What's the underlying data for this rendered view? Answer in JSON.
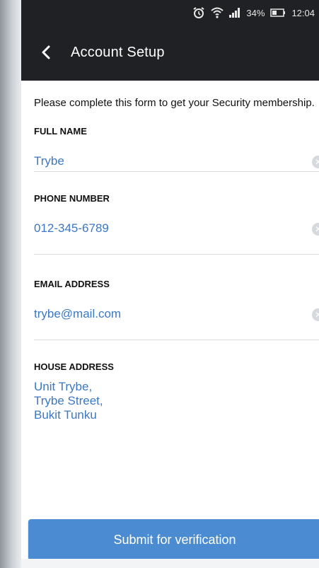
{
  "status_bar": {
    "battery": "34%",
    "time": "12:04",
    "icons": [
      "alarm-icon",
      "wifi-icon",
      "signal-icon",
      "battery-icon"
    ]
  },
  "app_bar": {
    "title": "Account Setup",
    "back_icon": "back-arrow-icon"
  },
  "form": {
    "intro": "Please complete this form to get your Security membership.",
    "fields": [
      {
        "label": "FULL NAME",
        "value": "Trybe"
      },
      {
        "label": "PHONE NUMBER",
        "value": "012-345-6789"
      },
      {
        "label": "EMAIL ADDRESS",
        "value": "trybe@mail.com"
      },
      {
        "label": "HOUSE ADDRESS",
        "value": "Unit Trybe,\nTrybe Street,\nBukit Tunku"
      }
    ]
  },
  "submit": {
    "label": "Submit for verification"
  },
  "colors": {
    "app_bar": "#202124",
    "accent": "#4a8bd1",
    "value_text": "#3b78c4"
  }
}
